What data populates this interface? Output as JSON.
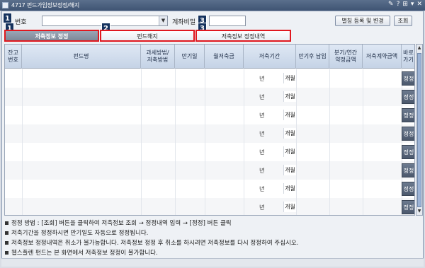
{
  "window": {
    "title": "4717 펀드가입정보정정/해지",
    "controls": [
      "✎",
      "?",
      "⊞",
      "▾",
      "✕"
    ]
  },
  "search": {
    "account_label": "번호",
    "password_label": "계좌비밀",
    "register_button": "별칭 등록 및 변경",
    "query_button": "조회"
  },
  "badges": [
    "1",
    "2",
    "3"
  ],
  "tabs": [
    {
      "label": "저축정보 정정",
      "active": true
    },
    {
      "label": "펀드해지",
      "active": false
    },
    {
      "label": "저축정보 정정내역",
      "active": false
    }
  ],
  "grid": {
    "headers": [
      "잔고\n번호",
      "펀드명",
      "과세방법/\n저축방법",
      "만기일",
      "월저축금",
      "저축기간",
      "만기후 납입",
      "분기/연간\n약정금액",
      "저축계약금액",
      "바로\n가기"
    ],
    "year_label": "년",
    "month_label": "개월",
    "action_label": "정정",
    "row_count": 8
  },
  "notes": [
    "정정 방법 : [조회] 버튼을 클릭하여 저축정보 조회 → 정정내역 입력 → [정정] 버튼 클릭",
    "저축기간을 정정하시면 만기일도 자동으로 정정됩니다.",
    "저축정보 정정내역은 취소가 불가능합니다. 저축정보 정정 후 취소를 하시려면 저축정보를 다시 정정하여 주십시오.",
    "웹스플렌 펀드는 본 화면에서 저축정보 정정이 불가합니다."
  ]
}
